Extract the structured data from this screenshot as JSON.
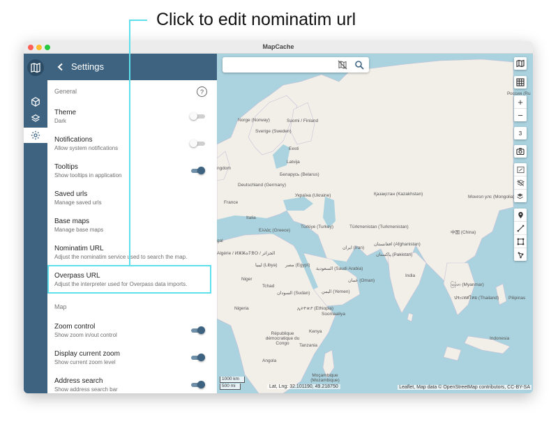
{
  "annotation": {
    "text": "Click to edit nominatim url",
    "accent_color": "#5ee0ec"
  },
  "window": {
    "title": "MapCache"
  },
  "rail": {
    "items": [
      {
        "icon": "map-logo-icon"
      },
      {
        "icon": "cube-icon"
      },
      {
        "icon": "layers-icon"
      },
      {
        "icon": "gear-icon",
        "active": true
      }
    ],
    "color": "#3d6381"
  },
  "settings": {
    "header": {
      "title": "Settings"
    },
    "general_title": "General",
    "map_title": "Map",
    "items": [
      {
        "title": "Theme",
        "subtitle": "Dark",
        "toggle": "off"
      },
      {
        "title": "Notifications",
        "subtitle": "Allow system notifications",
        "toggle": "off"
      },
      {
        "title": "Tooltips",
        "subtitle": "Show tooltips in application",
        "toggle": "on"
      },
      {
        "title": "Saved urls",
        "subtitle": "Manage saved urls"
      },
      {
        "title": "Base maps",
        "subtitle": "Manage base maps"
      },
      {
        "title": "Nominatim URL",
        "subtitle": "Adjust the nominatim service used to search the map."
      },
      {
        "title": "Overpass URL",
        "subtitle": "Adjust the interpreter used for Overpass data imports.",
        "highlighted": true
      }
    ],
    "map_items": [
      {
        "title": "Zoom control",
        "subtitle": "Show zoom in/out control",
        "toggle": "on"
      },
      {
        "title": "Display current zoom",
        "subtitle": "Show current zoom level",
        "toggle": "on"
      },
      {
        "title": "Address search",
        "subtitle": "Show address search bar",
        "toggle": "on"
      }
    ]
  },
  "map": {
    "search": {
      "value": "",
      "placeholder": ""
    },
    "zoom_level": "3",
    "controls": {
      "zoom_in": "+",
      "zoom_out": "−"
    },
    "labels": [
      "Norge (Norway)",
      "Suomi / Finland",
      "Sverige (Sweden)",
      "Россия (Ru",
      "Eesti",
      "Latvija",
      "Беларусь (Belarus)",
      "Deutschland (Germany)",
      "Україна (Ukraine)",
      "Қазақстан (Kazakhstan)",
      "Монгол улс (Mongolia)",
      "France",
      "Italia",
      "Ελλάς (Greece)",
      "Türkiye (Turkey)",
      "Türkmenistan (Turkmenistan)",
      "افغانستان (Afghanistan)",
      "中国 (China)",
      "Algérie / ⵍⵣⵣⴰⵢⴻⵔ / الجزائر",
      "ليبيا (Libya)",
      "مصر (Egypt)",
      "السعودية (Saudi Arabia)",
      "عمان (Oman)",
      "ایران (Iran)",
      "پاکستان (Pakistan)",
      "India",
      "မြန်မာ (Myanmar)",
      "ประเทศไทย (Thailand)",
      "Pilipinas",
      "Niger",
      "Nigeria",
      "Tchad",
      "السودان (Sudan)",
      "ኢትዮጵያ (Ethiopia)",
      "اليمن (Yemen)",
      "Soomaaliya",
      "Kenya",
      "Tanzania",
      "République démocratique du Congo",
      "Angola",
      "Moçambique (Mozambique)",
      "Indonesia",
      "ngdom",
      "gal",
      "Tchad"
    ],
    "scale": [
      "1000 km",
      "500 mi"
    ],
    "coords": "Lat, Lng: 32.101190, 49.218750",
    "attribution": "Leaflet, Map data © OpenStreetMap contributors, CC-BY-SA",
    "water_color": "#aad3df",
    "land_color": "#f2efe9"
  }
}
